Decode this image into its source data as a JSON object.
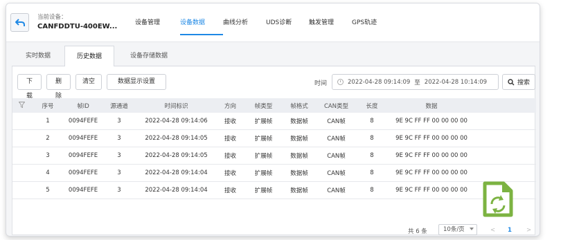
{
  "header": {
    "device_label": "当前设备：",
    "device_name": "CANFDDTU-400EW...",
    "nav": [
      {
        "label": "设备管理"
      },
      {
        "label": "设备数据"
      },
      {
        "label": "曲线分析"
      },
      {
        "label": "UDS诊断"
      },
      {
        "label": "触发管理"
      },
      {
        "label": "GPS轨迹"
      }
    ],
    "active_nav": "设备数据"
  },
  "subtabs": [
    {
      "label": "实时数据"
    },
    {
      "label": "历史数据"
    },
    {
      "label": "设备存储数据"
    }
  ],
  "toolbar": {
    "download": "下载",
    "delete": "删除",
    "clear": "清空",
    "display_settings": "数据显示设置",
    "time_label": "时间",
    "start_time": "2022-04-28 09:14:09",
    "to": "至",
    "end_time": "2022-04-28 10:14:09",
    "search": "搜索"
  },
  "table": {
    "columns": [
      "序号",
      "帧ID",
      "源通道",
      "时间标识",
      "方向",
      "帧类型",
      "帧格式",
      "CAN类型",
      "长度",
      "数据"
    ],
    "rows": [
      [
        "1",
        "0094FEFE",
        "3",
        "2022-04-28 09:14:06",
        "接收",
        "扩展帧",
        "数据帧",
        "CAN帧",
        "8",
        "9E 9C FF FF 00 00 00 00"
      ],
      [
        "2",
        "0094FEFE",
        "3",
        "2022-04-28 09:14:05",
        "接收",
        "扩展帧",
        "数据帧",
        "CAN帧",
        "8",
        "9E 9C FF FF 00 00 00 00"
      ],
      [
        "3",
        "0094FEFE",
        "3",
        "2022-04-28 09:14:05",
        "接收",
        "扩展帧",
        "数据帧",
        "CAN帧",
        "8",
        "9E 9C FF FF 00 00 00 00"
      ],
      [
        "4",
        "0094FEFE",
        "3",
        "2022-04-28 09:14:04",
        "接收",
        "扩展帧",
        "数据帧",
        "CAN帧",
        "8",
        "9E 9C FF FF 00 00 00 00"
      ],
      [
        "5",
        "0094FEFE",
        "3",
        "2022-04-28 09:14:04",
        "接收",
        "扩展帧",
        "数据帧",
        "CAN帧",
        "8",
        "9E 9C FF FF 00 00 00 00"
      ]
    ]
  },
  "pagination": {
    "total": "共 6 条",
    "page_size": "10条/页",
    "prev": "<",
    "current": "1",
    "next": ">"
  },
  "colors": {
    "accent": "#1e88e5",
    "badge_green": "#7cb342"
  }
}
